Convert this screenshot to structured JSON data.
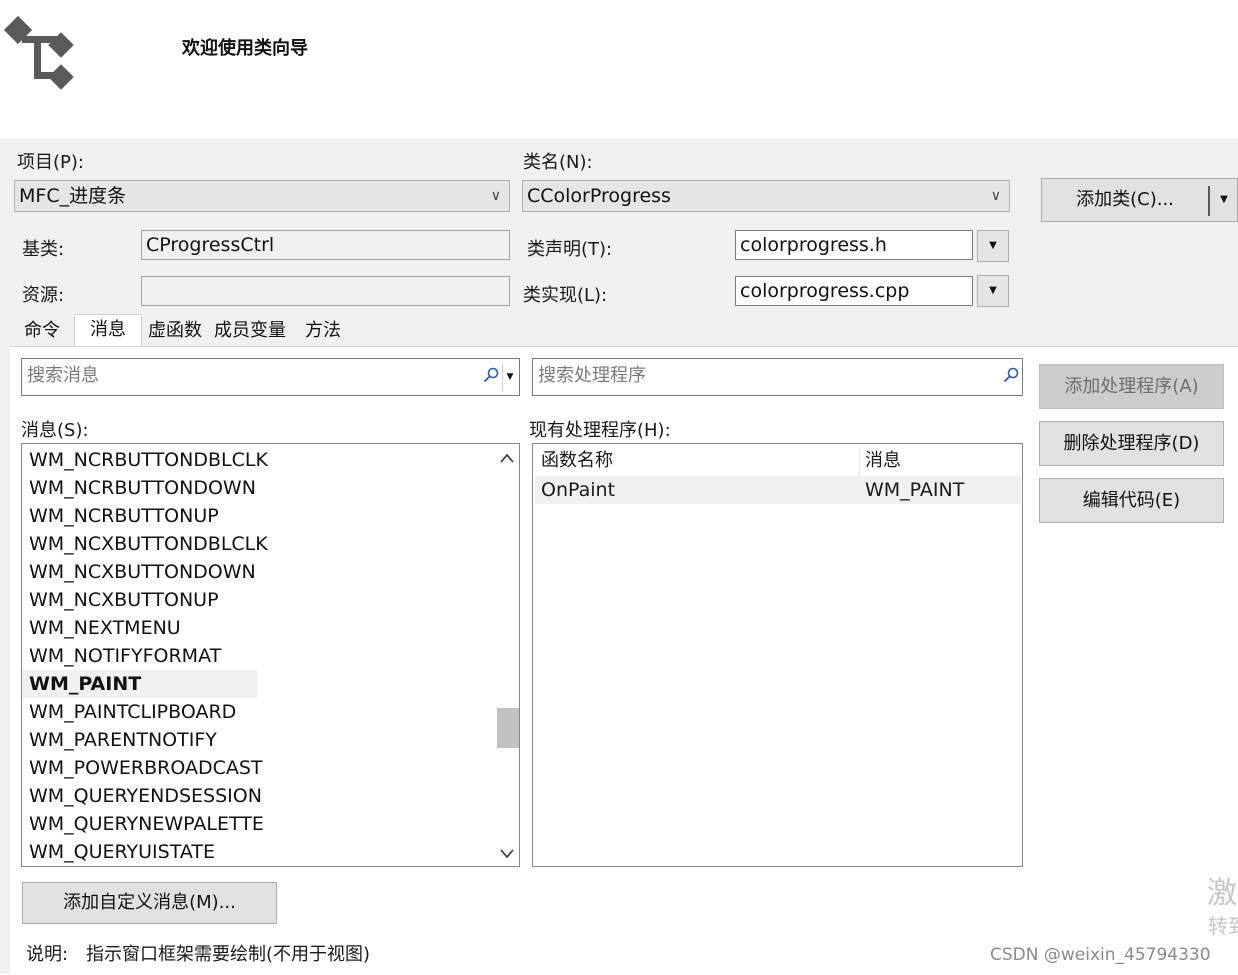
{
  "header": {
    "title": "欢迎使用类向导"
  },
  "project": {
    "label": "项目(P):",
    "value": "MFC_进度条"
  },
  "classname": {
    "label": "类名(N):",
    "value": "CColorProgress"
  },
  "add_class_button": "添加类(C)...",
  "base_class": {
    "label": "基类:",
    "value": "CProgressCtrl"
  },
  "resource": {
    "label": "资源:",
    "value": ""
  },
  "class_decl": {
    "label": "类声明(T):",
    "value": "colorprogress.h"
  },
  "class_impl": {
    "label": "类实现(L):",
    "value": "colorprogress.cpp"
  },
  "tabs": [
    "命令",
    "消息",
    "虚函数",
    "成员变量",
    "方法"
  ],
  "active_tab": "消息",
  "search_messages": {
    "placeholder": "搜索消息"
  },
  "search_handlers": {
    "placeholder": "搜索处理程序"
  },
  "messages": {
    "label": "消息(S):",
    "items": [
      "WM_NCRBUTTONDBLCLK",
      "WM_NCRBUTTONDOWN",
      "WM_NCRBUTTONUP",
      "WM_NCXBUTTONDBLCLK",
      "WM_NCXBUTTONDOWN",
      "WM_NCXBUTTONUP",
      "WM_NEXTMENU",
      "WM_NOTIFYFORMAT",
      "WM_PAINT",
      "WM_PAINTCLIPBOARD",
      "WM_PARENTNOTIFY",
      "WM_POWERBROADCAST",
      "WM_QUERYENDSESSION",
      "WM_QUERYNEWPALETTE",
      "WM_QUERYUISTATE"
    ],
    "selected": "WM_PAINT"
  },
  "handlers": {
    "label": "现有处理程序(H):",
    "columns": [
      "函数名称",
      "消息"
    ],
    "rows": [
      {
        "function": "OnPaint",
        "message": "WM_PAINT"
      }
    ]
  },
  "buttons": {
    "add_handler": "添加处理程序(A)",
    "delete_handler": "删除处理程序(D)",
    "edit_code": "编辑代码(E)",
    "add_custom_message": "添加自定义消息(M)..."
  },
  "description": {
    "label": "说明:",
    "text": "指示窗口框架需要绘制(不用于视图)"
  },
  "watermark": {
    "text": "CSDN @weixin_45794330",
    "side_big": "激",
    "side_small": "转到"
  },
  "colors": {
    "panel_bg": "#f0f0f0",
    "button_bg": "#e1e1e1",
    "disabled_button_bg": "#cccccc",
    "logo": "#5a5a5a"
  }
}
